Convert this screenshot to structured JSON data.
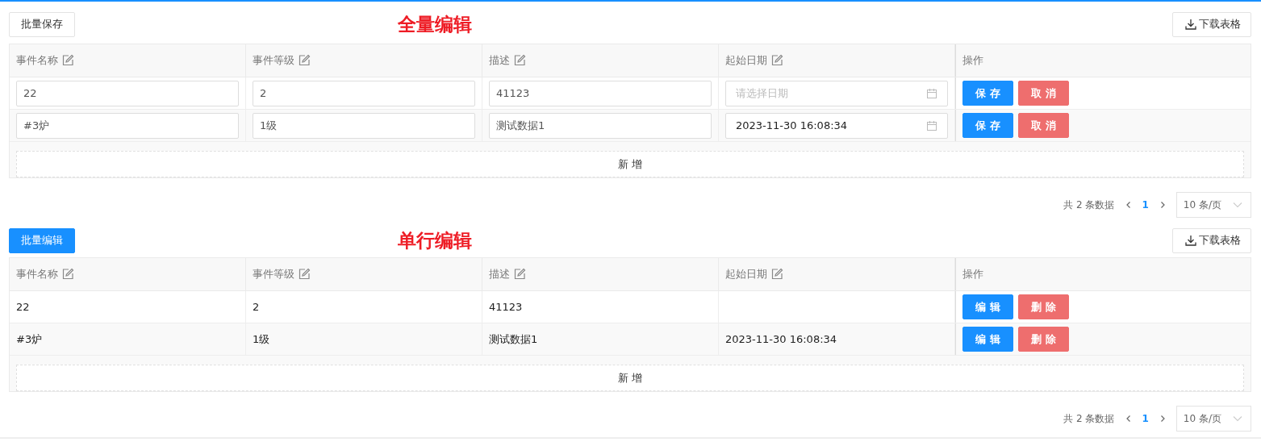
{
  "sections": [
    {
      "toolbar_button": {
        "label": "批量保存",
        "kind": "default"
      },
      "title": "全量编辑",
      "download_button": "下载表格",
      "columns": [
        {
          "label": "事件名称",
          "editable": true
        },
        {
          "label": "事件等级",
          "editable": true
        },
        {
          "label": "描述",
          "editable": true
        },
        {
          "label": "起始日期",
          "editable": true
        },
        {
          "label": "操作",
          "editable": false
        }
      ],
      "rows": [
        {
          "cells": [
            {
              "kind": "input",
              "value": "22"
            },
            {
              "kind": "input",
              "value": "2"
            },
            {
              "kind": "input",
              "value": "41123"
            },
            {
              "kind": "date",
              "placeholder": "请选择日期"
            }
          ],
          "actions": [
            {
              "label": "保 存",
              "kind": "primary"
            },
            {
              "label": "取 消",
              "kind": "danger"
            }
          ]
        },
        {
          "cells": [
            {
              "kind": "input",
              "value": "#3炉"
            },
            {
              "kind": "input",
              "value": "1级"
            },
            {
              "kind": "input",
              "value": "测试数据1"
            },
            {
              "kind": "date",
              "value": "2023-11-30 16:08:34"
            }
          ],
          "actions": [
            {
              "label": "保 存",
              "kind": "primary"
            },
            {
              "label": "取 消",
              "kind": "danger"
            }
          ]
        }
      ],
      "add_button": "新 增",
      "pagination": {
        "total": "共 2 条数据",
        "pages": [
          {
            "label": "1",
            "selected": true
          }
        ],
        "page_size": "10 条/页"
      }
    },
    {
      "toolbar_button": {
        "label": "批量编辑",
        "kind": "primary"
      },
      "title": "单行编辑",
      "download_button": "下载表格",
      "columns": [
        {
          "label": "事件名称",
          "editable": true
        },
        {
          "label": "事件等级",
          "editable": true
        },
        {
          "label": "描述",
          "editable": true
        },
        {
          "label": "起始日期",
          "editable": true
        },
        {
          "label": "操作",
          "editable": false
        }
      ],
      "rows": [
        {
          "cells": [
            {
              "kind": "text",
              "value": "22"
            },
            {
              "kind": "text",
              "value": "2"
            },
            {
              "kind": "text",
              "value": "41123"
            },
            {
              "kind": "text"
            }
          ],
          "actions": [
            {
              "label": "编 辑",
              "kind": "primary"
            },
            {
              "label": "删 除",
              "kind": "danger"
            }
          ]
        },
        {
          "cells": [
            {
              "kind": "text",
              "value": "#3炉"
            },
            {
              "kind": "text",
              "value": "1级"
            },
            {
              "kind": "text",
              "value": "测试数据1"
            },
            {
              "kind": "text",
              "value": "2023-11-30 16:08:34"
            }
          ],
          "actions": [
            {
              "label": "编 辑",
              "kind": "primary"
            },
            {
              "label": "删 除",
              "kind": "danger"
            }
          ]
        }
      ],
      "add_button": "新 增",
      "pagination": {
        "total": "共 2 条数据",
        "pages": [
          {
            "label": "1",
            "selected": true
          }
        ],
        "page_size": "10 条/页"
      }
    }
  ]
}
